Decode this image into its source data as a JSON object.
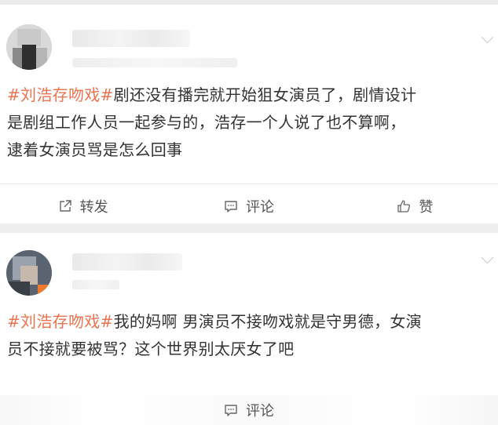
{
  "posts": [
    {
      "hashtag": "#刘浩存吻戏#",
      "line1_rest": "剧还没有播完就开始狙女演员了，剧情设计",
      "line2": "是剧组工作人员一起参与的，浩存一个人说了也不算啊，",
      "line3": "逮着女演员骂是怎么回事",
      "actions": {
        "repost": "转发",
        "comment": "评论",
        "like": "赞"
      }
    },
    {
      "hashtag": "#刘浩存吻戏#",
      "line1_rest": "我的妈啊 男演员不接吻戏就是守男德，女演",
      "line2": "员不接就要被骂？这个世界别太厌女了吧",
      "actions": {
        "comment": "评论"
      }
    }
  ],
  "colors": {
    "hashtag": "#eb7350",
    "text": "#333333",
    "action_text": "#555555"
  },
  "icons": {
    "repost": "repost-icon",
    "comment": "comment-icon",
    "like": "thumbs-up-icon",
    "more": "chevron-down-icon"
  }
}
